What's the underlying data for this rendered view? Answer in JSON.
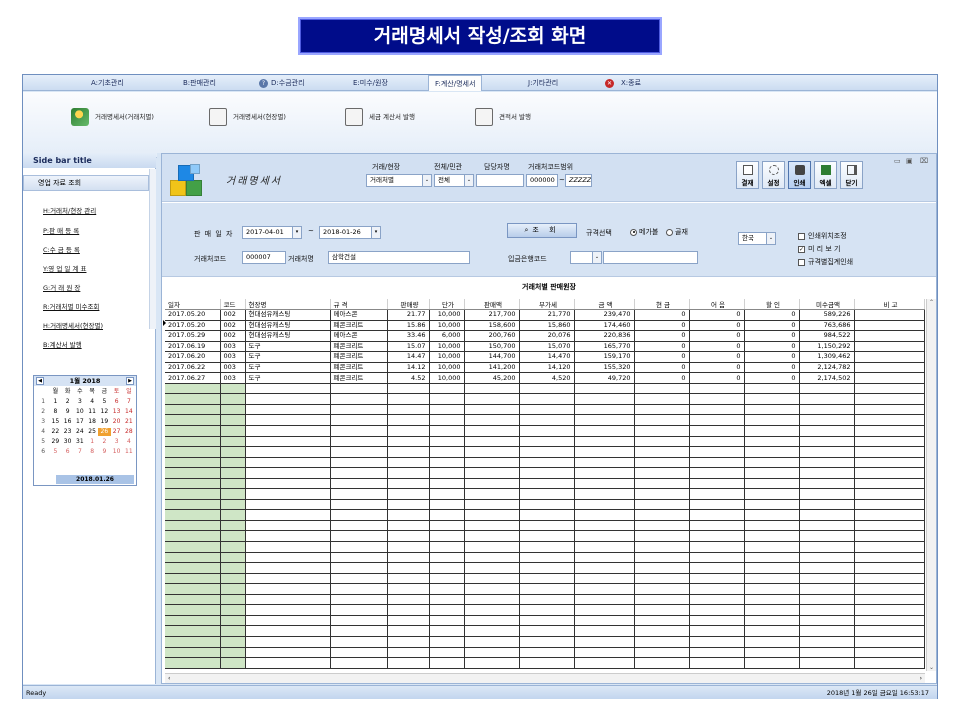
{
  "banner": {
    "title": "거래명세서 작성/조회 화면"
  },
  "ribbon_tabs": [
    {
      "label": "A:기초관리"
    },
    {
      "label": "B:판매관리"
    },
    {
      "label": "D:수금관리"
    },
    {
      "label": "E:미수/원장"
    },
    {
      "label": "F:계산/명세서"
    },
    {
      "label": "J:기타관리"
    },
    {
      "label": "X:종료"
    }
  ],
  "ribbon_buttons": [
    {
      "label": "거래명세서(거래처별)",
      "icon": "user-group-icon"
    },
    {
      "label": "거래명세서(현장별)",
      "icon": "document-icon"
    },
    {
      "label": "세금 계산서 발행",
      "icon": "document-icon"
    },
    {
      "label": "견적서 발행",
      "icon": "document-icon"
    }
  ],
  "sidebar": {
    "title": "Side bar title",
    "section": "영업 자료 조회",
    "items": [
      {
        "label": "H:거래처/현장 관리"
      },
      {
        "label": "P:판 매 등 록"
      },
      {
        "label": "C:수 금 등 록"
      },
      {
        "label": "Y:영 업 일 계 표"
      },
      {
        "label": "G:거 래 원 장"
      },
      {
        "label": "R:거래처별 미수조회"
      },
      {
        "label": "H:거래명세서(현장별)"
      },
      {
        "label": "B:계산서 발행"
      }
    ],
    "calendar": {
      "month_title": "1월 2018",
      "weekdays": [
        "월",
        "화",
        "수",
        "목",
        "금",
        "토",
        "일"
      ],
      "weeks": [
        {
          "wk": "1",
          "days": [
            "1",
            "2",
            "3",
            "4",
            "5",
            "6",
            "7"
          ]
        },
        {
          "wk": "2",
          "days": [
            "8",
            "9",
            "10",
            "11",
            "12",
            "13",
            "14"
          ]
        },
        {
          "wk": "3",
          "days": [
            "15",
            "16",
            "17",
            "18",
            "19",
            "20",
            "21"
          ]
        },
        {
          "wk": "4",
          "days": [
            "22",
            "23",
            "24",
            "25",
            "26",
            "27",
            "28"
          ]
        },
        {
          "wk": "5",
          "days": [
            "29",
            "30",
            "31",
            "1",
            "2",
            "3",
            "4"
          ]
        },
        {
          "wk": "6",
          "days": [
            "5",
            "6",
            "7",
            "8",
            "9",
            "10",
            "11"
          ]
        }
      ],
      "today_label": "2018.01.26"
    }
  },
  "header": {
    "title": "거래명세서",
    "f1_label": "거래/현장",
    "f1_value": "거래처별",
    "f2_label": "전체/민관",
    "f2_value": "전체",
    "f3_label": "담당자명",
    "f3_value": "",
    "f4_label": "거래처코드범위",
    "f4_from": "000000",
    "f4_sep": "~",
    "f4_to": "ZZZZZZ",
    "buttons": [
      {
        "label": "결재"
      },
      {
        "label": "설정"
      },
      {
        "label": "인쇄"
      },
      {
        "label": "엑셀"
      },
      {
        "label": "닫기"
      }
    ]
  },
  "filter": {
    "date_label": "판 매 일 자",
    "date_from": "2017-04-01",
    "date_sep": "~",
    "date_to": "2018-01-26",
    "code_label": "거래처코드",
    "code_value": "000007",
    "name_label": "거래처명",
    "name_value": "삼학건설",
    "search_label": "조 회",
    "spec_label": "규격선택",
    "radio1": "메가볼",
    "radio2": "골재",
    "bank_label": "입금은행코드",
    "bank_value": "",
    "lang_value": "한국",
    "chk1": "인쇄위치조정",
    "chk2": "미 리 보 기",
    "chk3": "규격별집계인쇄"
  },
  "grid": {
    "title": "거래처별 판매원장",
    "columns": [
      "일자",
      "코드",
      "현장명",
      "규 격",
      "판매량",
      "단가",
      "판매액",
      "부가세",
      "금 액",
      "현 금",
      "어 음",
      "할 인",
      "미수금액",
      "비 고"
    ],
    "rows": [
      [
        "2017.05.20",
        "002",
        "현대섬유캐스팅",
        "메아스콘",
        "21.77",
        "10,000",
        "217,700",
        "21,770",
        "239,470",
        "0",
        "0",
        "0",
        "589,226",
        ""
      ],
      [
        "2017.05.20",
        "002",
        "현대섬유캐스팅",
        "폐콘크리트",
        "15.86",
        "10,000",
        "158,600",
        "15,860",
        "174,460",
        "0",
        "0",
        "0",
        "763,686",
        ""
      ],
      [
        "2017.05.29",
        "002",
        "현대섬유캐스팅",
        "메아스콘",
        "33.46",
        "6,000",
        "200,760",
        "20,076",
        "220,836",
        "0",
        "0",
        "0",
        "984,522",
        ""
      ],
      [
        "2017.06.19",
        "003",
        "도구",
        "폐콘크리트",
        "15.07",
        "10,000",
        "150,700",
        "15,070",
        "165,770",
        "0",
        "0",
        "0",
        "1,150,292",
        ""
      ],
      [
        "2017.06.20",
        "003",
        "도구",
        "폐콘크리트",
        "14.47",
        "10,000",
        "144,700",
        "14,470",
        "159,170",
        "0",
        "0",
        "0",
        "1,309,462",
        ""
      ],
      [
        "2017.06.22",
        "003",
        "도구",
        "폐콘크리트",
        "14.12",
        "10,000",
        "141,200",
        "14,120",
        "155,320",
        "0",
        "0",
        "0",
        "2,124,782",
        ""
      ],
      [
        "2017.06.27",
        "003",
        "도구",
        "폐콘크리트",
        "4.52",
        "10,000",
        "45,200",
        "4,520",
        "49,720",
        "0",
        "0",
        "0",
        "2,174,502",
        ""
      ]
    ]
  },
  "status": {
    "left": "Ready",
    "right": "2018년 1월 26일 금요일 16:53:17"
  }
}
